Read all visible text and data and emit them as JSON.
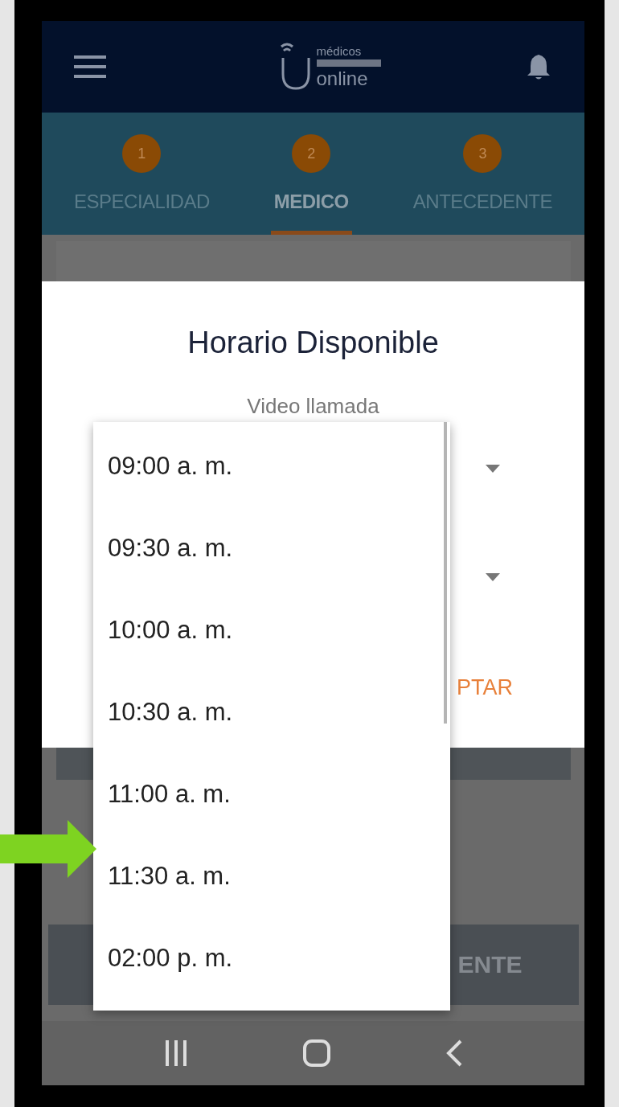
{
  "header": {
    "logo": {
      "top": "médicos",
      "bottom": "online"
    }
  },
  "steps": [
    {
      "number": "1",
      "label": "ESPECIALIDAD",
      "selected": false
    },
    {
      "number": "2",
      "label": "MEDICO",
      "selected": true
    },
    {
      "number": "3",
      "label": "ANTECEDENTE",
      "selected": false
    }
  ],
  "dialog": {
    "title": "Horario Disponible",
    "subtitle": "Video llamada",
    "action": "PTAR"
  },
  "menu": {
    "items": [
      {
        "label": "09:00 a. m.",
        "selected": false
      },
      {
        "label": "09:30 a. m.",
        "selected": false
      },
      {
        "label": "10:00 a. m.",
        "selected": false
      },
      {
        "label": "10:30 a. m.",
        "selected": false
      },
      {
        "label": "11:00 a. m.",
        "selected": false
      },
      {
        "label": "11:30 a. m.",
        "selected": false
      },
      {
        "label": "02:00 p. m.",
        "selected": false
      }
    ]
  },
  "bottom_button": "ENTE"
}
